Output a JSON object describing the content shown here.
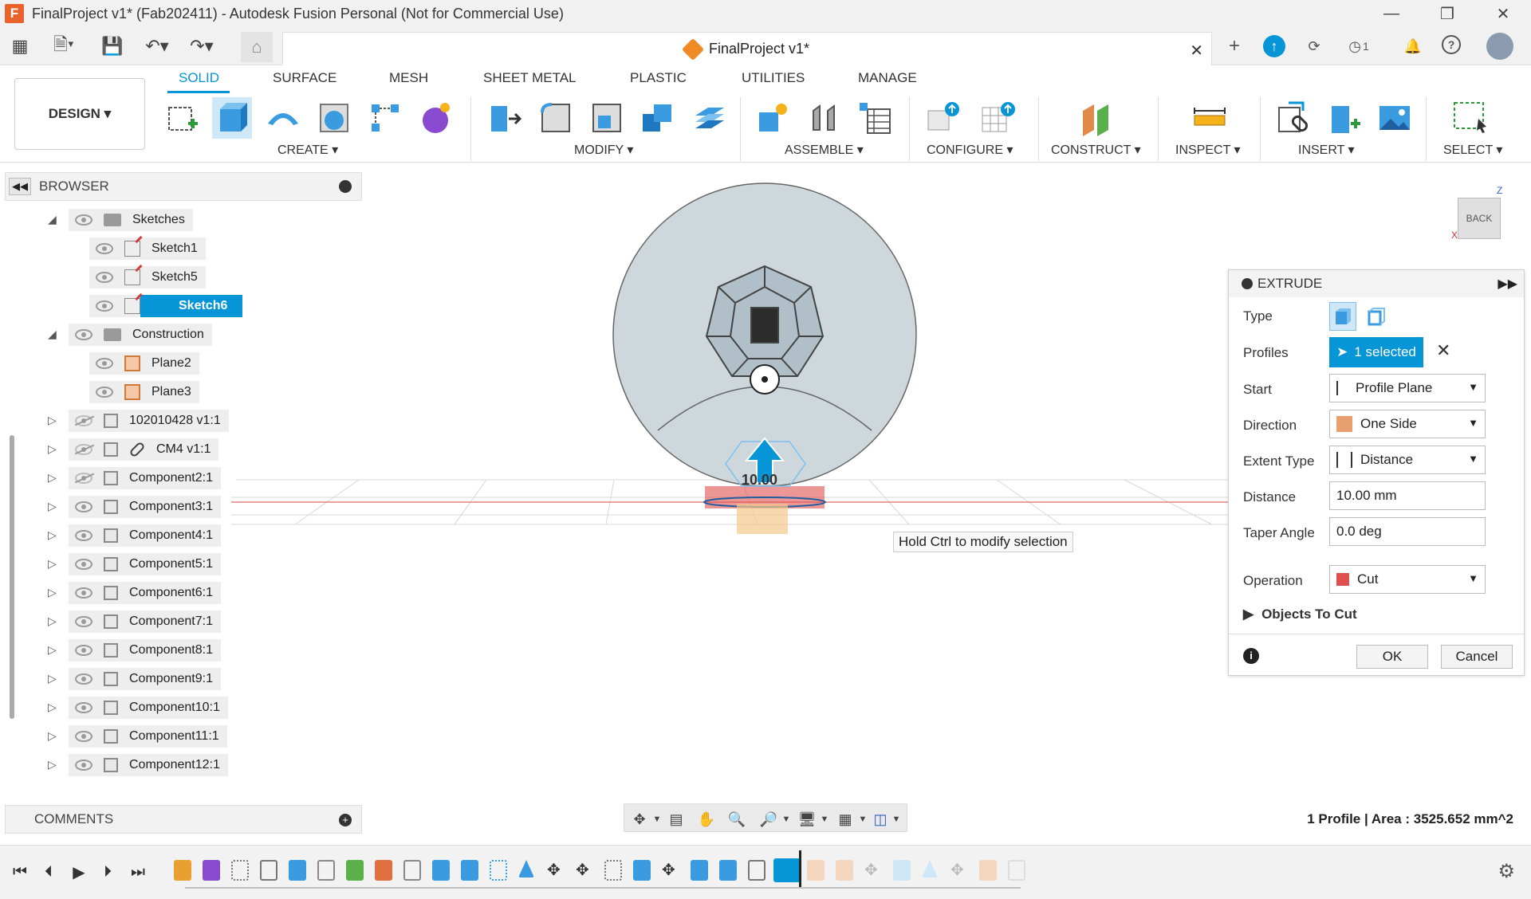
{
  "window": {
    "title": "FinalProject v1* (Fab202411) - Autodesk Fusion Personal (Not for Commercial Use)",
    "logo": "F"
  },
  "document_tab": {
    "title": "FinalProject v1*",
    "jobs_count": "1"
  },
  "ribbon": {
    "workspace": "DESIGN",
    "tabs": [
      "SOLID",
      "SURFACE",
      "MESH",
      "SHEET METAL",
      "PLASTIC",
      "UTILITIES",
      "MANAGE"
    ],
    "active_tab": "SOLID",
    "groups": [
      "CREATE",
      "MODIFY",
      "ASSEMBLE",
      "CONFIGURE",
      "CONSTRUCT",
      "INSPECT",
      "INSERT",
      "SELECT"
    ]
  },
  "browser": {
    "title": "BROWSER",
    "items": [
      {
        "label": "Sketches",
        "type": "folder",
        "expanded": true
      },
      {
        "label": "Sketch1",
        "type": "sketch"
      },
      {
        "label": "Sketch5",
        "type": "sketch"
      },
      {
        "label": "Sketch6",
        "type": "sketch",
        "selected": true
      },
      {
        "label": "Construction",
        "type": "folder",
        "expanded": true
      },
      {
        "label": "Plane2",
        "type": "plane"
      },
      {
        "label": "Plane3",
        "type": "plane"
      },
      {
        "label": "102010428 v1:1",
        "type": "component",
        "visible": false
      },
      {
        "label": "CM4 v1:1",
        "type": "component-link",
        "visible": false
      },
      {
        "label": "Component2:1",
        "type": "component",
        "visible": false
      },
      {
        "label": "Component3:1",
        "type": "component"
      },
      {
        "label": "Component4:1",
        "type": "component"
      },
      {
        "label": "Component5:1",
        "type": "component"
      },
      {
        "label": "Component6:1",
        "type": "component"
      },
      {
        "label": "Component7:1",
        "type": "component"
      },
      {
        "label": "Component8:1",
        "type": "component"
      },
      {
        "label": "Component9:1",
        "type": "component"
      },
      {
        "label": "Component10:1",
        "type": "component"
      },
      {
        "label": "Component11:1",
        "type": "component"
      },
      {
        "label": "Component12:1",
        "type": "component"
      }
    ]
  },
  "comments": {
    "title": "COMMENTS"
  },
  "viewport": {
    "tooltip": "Hold Ctrl to modify selection",
    "dimension_label": "10.00",
    "viewcube_face": "BACK",
    "axis_z": "Z",
    "axis_x": "X"
  },
  "extrude": {
    "title": "EXTRUDE",
    "type_label": "Type",
    "profiles_label": "Profiles",
    "profiles_value": "1 selected",
    "start_label": "Start",
    "start_value": "Profile Plane",
    "direction_label": "Direction",
    "direction_value": "One Side",
    "extent_label": "Extent Type",
    "extent_value": "Distance",
    "distance_label": "Distance",
    "distance_value": "10.00 mm",
    "taper_label": "Taper Angle",
    "taper_value": "0.0 deg",
    "operation_label": "Operation",
    "operation_value": "Cut",
    "objects_to_cut": "Objects To Cut",
    "ok": "OK",
    "cancel": "Cancel"
  },
  "status": {
    "text": "1 Profile | Area : 3525.652 mm^2"
  },
  "colors": {
    "accent": "#0696d7",
    "logo": "#e8632b",
    "cut_red": "#e05050",
    "plane_orange": "#f5c9a8"
  }
}
